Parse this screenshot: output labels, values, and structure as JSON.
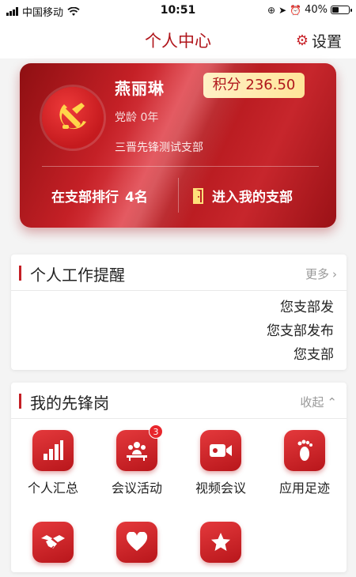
{
  "status_bar": {
    "carrier": "中国移动",
    "time": "10:51",
    "battery_text": "40%",
    "battery_level": 0.4
  },
  "header": {
    "title": "个人中心",
    "settings_label": "设置"
  },
  "profile": {
    "name": "燕丽琳",
    "points": "积分 236.50",
    "party_age": "党龄 0年",
    "branch": "三晋先锋测试支部",
    "rank_label": "在支部排行",
    "rank_value": "4名",
    "enter_branch_label": "进入我的支部"
  },
  "reminders": {
    "title": "个人工作提醒",
    "more_label": "更多",
    "items": [
      "您支部发",
      "您支部发布",
      "您支部"
    ]
  },
  "vanguard": {
    "title": "我的先锋岗",
    "collapse_label": "收起",
    "items": [
      {
        "label": "个人汇总",
        "icon": "bar-chart-icon"
      },
      {
        "label": "会议活动",
        "icon": "meeting-icon",
        "badge": "3"
      },
      {
        "label": "视频会议",
        "icon": "video-camera-icon"
      },
      {
        "label": "应用足迹",
        "icon": "footprint-icon"
      },
      {
        "label": "",
        "icon": "handshake-icon"
      },
      {
        "label": "",
        "icon": "heart-icon"
      },
      {
        "label": "",
        "icon": "star-icon"
      }
    ]
  },
  "colors": {
    "brand_red": "#c41f25",
    "title_red": "#b0161c",
    "points_bg": "#ffe599"
  }
}
